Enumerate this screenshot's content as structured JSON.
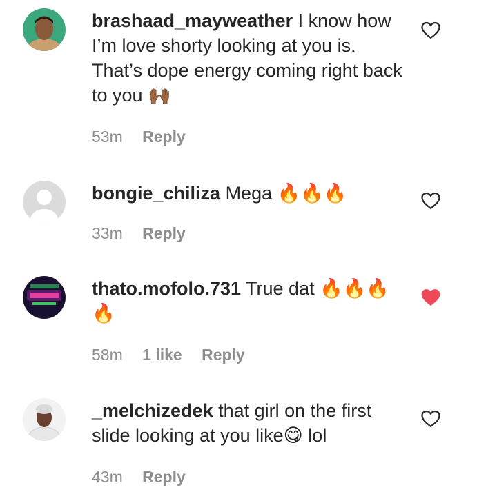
{
  "comments": [
    {
      "username": "brashaad_mayweather",
      "text": "I know how I’m love shorty looking at you is. That’s dope energy coming right back to you 🙌🏾",
      "time": "53m",
      "likes": "",
      "reply": "Reply",
      "liked": false
    },
    {
      "username": "bongie_chiliza",
      "text": "Mega 🔥🔥🔥",
      "time": "33m",
      "likes": "",
      "reply": "Reply",
      "liked": false
    },
    {
      "username": "thato.mofolo.731",
      "text": "True dat 🔥🔥🔥🔥",
      "time": "58m",
      "likes": "1 like",
      "reply": "Reply",
      "liked": true
    },
    {
      "username": "_melchizedek",
      "text": "that girl on the first slide looking at you like😋 lol",
      "time": "43m",
      "likes": "",
      "reply": "Reply",
      "liked": false
    }
  ],
  "colors": {
    "heart_liked": "#ed4956",
    "meta_text": "#8e8e8e",
    "text": "#262626"
  },
  "icons": [
    "heart-outline-icon",
    "heart-filled-icon"
  ]
}
